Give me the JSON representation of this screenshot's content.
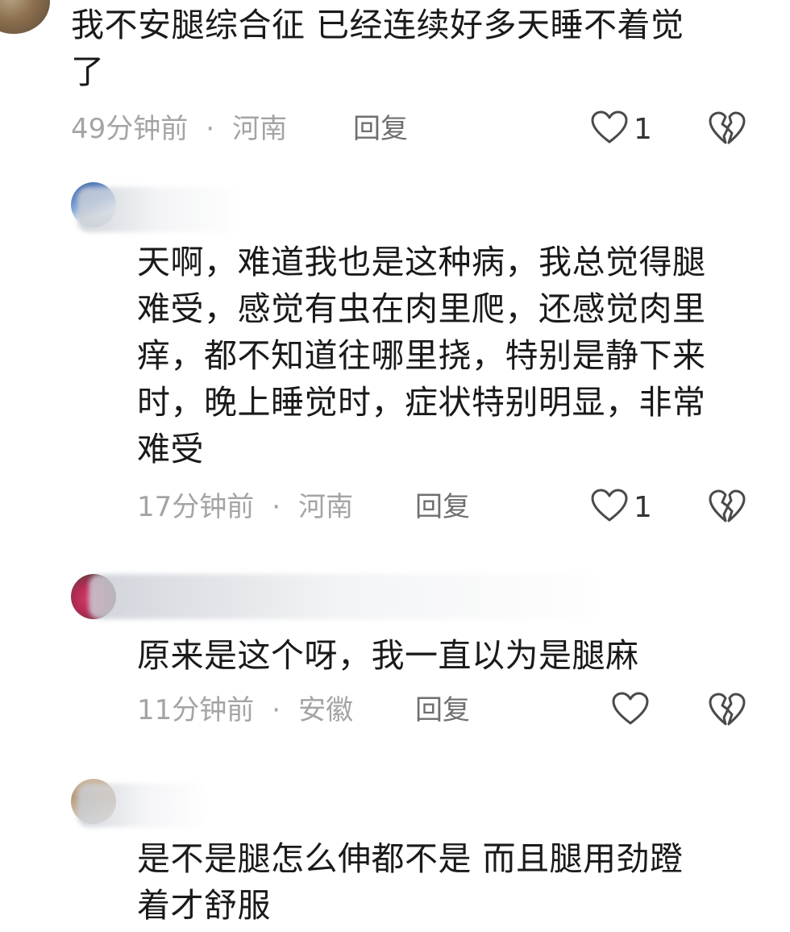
{
  "comments": [
    {
      "text_line1": "我不安腿综合征 已经连续好多天睡不着觉",
      "text_line2": "了",
      "time": "49分钟前",
      "dot": "·",
      "location": "河南",
      "reply_label": "回复",
      "likes": "1"
    },
    {
      "text_lines": [
        "天啊，难道我也是这种病，我总觉得腿",
        "难受，感觉有虫在肉里爬，还感觉肉里",
        "痒，都不知道往哪里挠，特别是静下来",
        "时，晚上睡觉时，症状特别明显，非常",
        "难受"
      ],
      "time": "17分钟前",
      "dot": "·",
      "location": "河南",
      "reply_label": "回复",
      "likes": "1"
    },
    {
      "text_lines": [
        "原来是这个呀，我一直以为是腿麻"
      ],
      "time": "11分钟前",
      "dot": "·",
      "location": "安徽",
      "reply_label": "回复",
      "likes": ""
    },
    {
      "text_lines": [
        "是不是腿怎么伸都不是 而且腿用劲蹬",
        "着才舒服"
      ]
    }
  ],
  "icons": {
    "like": "heart-outline-icon",
    "dislike": "broken-heart-icon"
  }
}
